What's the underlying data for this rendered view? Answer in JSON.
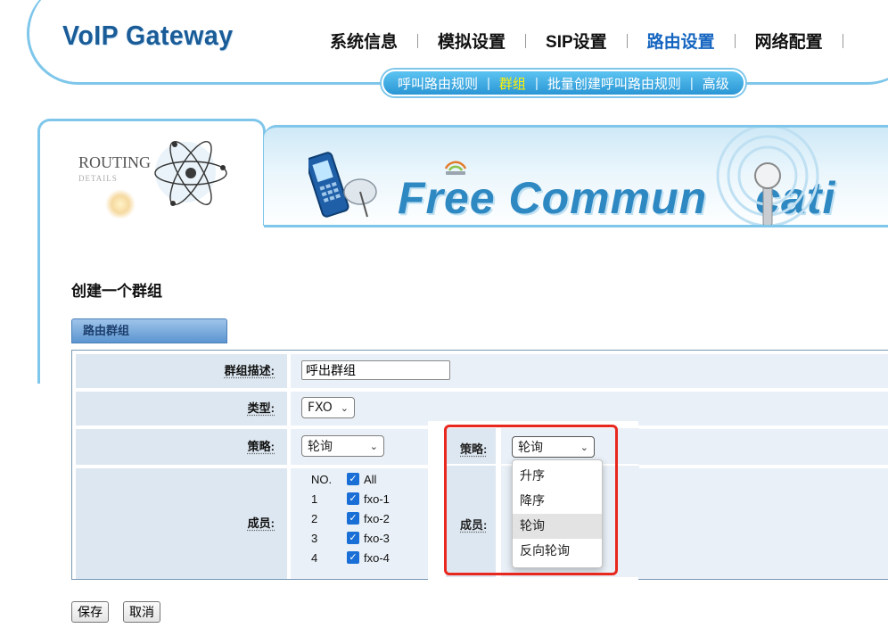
{
  "header": {
    "logo": "VoIP Gateway",
    "nav": [
      "系统信息",
      "模拟设置",
      "SIP设置",
      "路由设置",
      "网络配置"
    ],
    "active_nav": "路由设置",
    "subnav": [
      "呼叫路由规则",
      "群组",
      "批量创建呼叫路由规则",
      "高级"
    ],
    "active_subnav": "群组"
  },
  "banner": {
    "routing_title": "ROUTING",
    "routing_sub": "DETAILS",
    "slogan": "Free Commun",
    "slogan_tail": "cati"
  },
  "page": {
    "title": "创建一个群组",
    "tab": "路由群组"
  },
  "form": {
    "desc_label": "群组描述:",
    "desc_value": "呼出群组",
    "type_label": "类型:",
    "type_value": "FXO",
    "strategy_label": "策略:",
    "strategy_value": "轮询",
    "members_label": "成员:",
    "members": {
      "header_no": "NO.",
      "header_all": "All",
      "rows": [
        {
          "no": "1",
          "name": "fxo-1",
          "checked": true
        },
        {
          "no": "2",
          "name": "fxo-2",
          "checked": true
        },
        {
          "no": "3",
          "name": "fxo-3",
          "checked": true
        },
        {
          "no": "4",
          "name": "fxo-4",
          "checked": true
        }
      ]
    }
  },
  "overlay": {
    "strategy_label": "策略:",
    "strategy_value": "轮询",
    "members_label": "成员:",
    "options": [
      "升序",
      "降序",
      "轮询",
      "反向轮询"
    ],
    "selected_option": "轮询",
    "highlight_color": "#e8281e"
  },
  "buttons": {
    "save": "保存",
    "cancel": "取消"
  },
  "colors": {
    "brand": "#1a5c98",
    "active_nav": "#1565c0",
    "subnav_active": "#fff200",
    "label_bg": "#dde7f1",
    "value_bg": "#e9f0f7",
    "checkbox": "#1a6fd6"
  }
}
